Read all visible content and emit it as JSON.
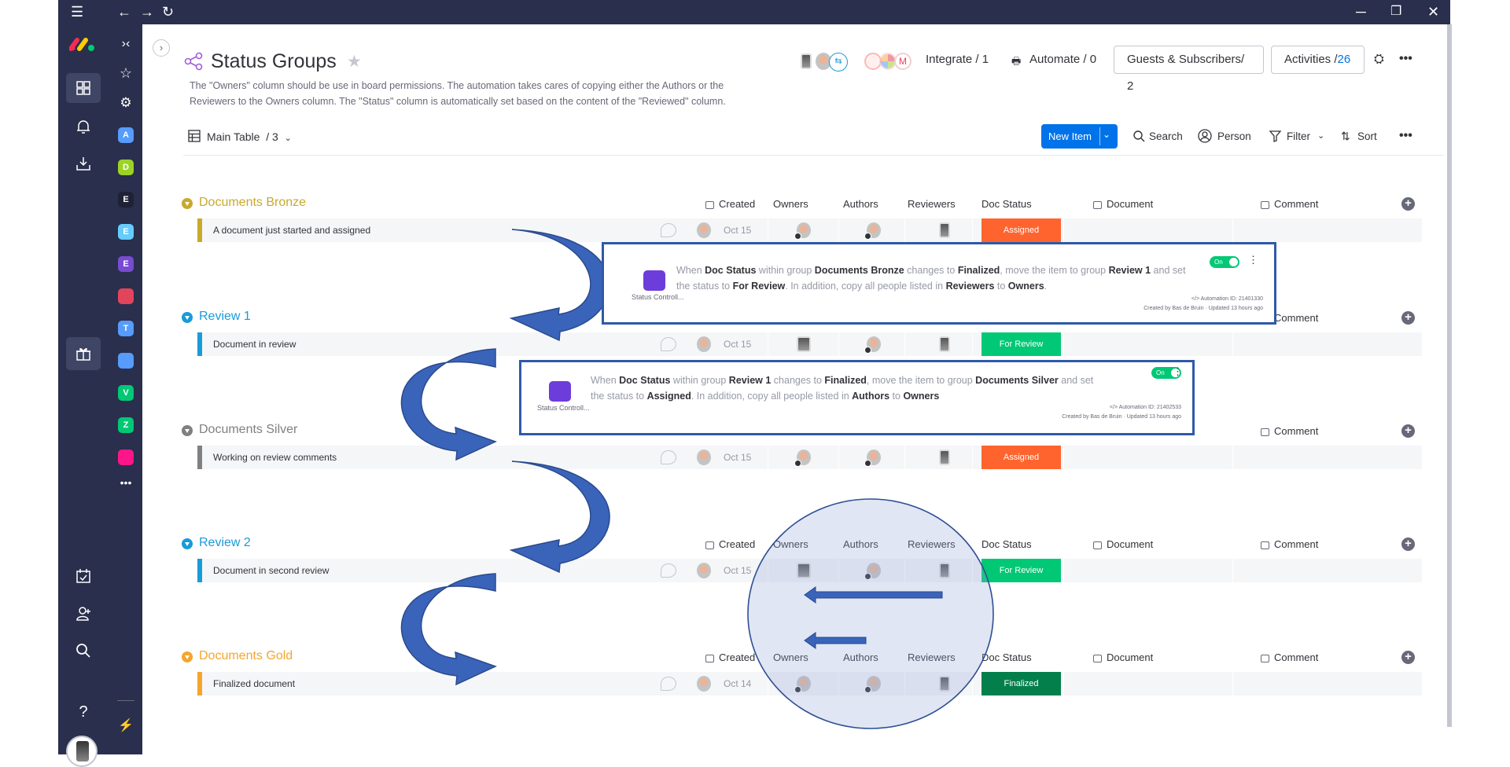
{
  "board": {
    "title": "Status Groups",
    "description_line1": "The \"Owners\" column should be use in board permissions. The automation takes cares of copying either the Authors or the",
    "description_line2": "Reviewers to the Owners column. The \"Status\" column is automatically set based on the content of the \"Reviewed\" column.",
    "integrate": "Integrate / 1",
    "automate": "Automate / 0",
    "guests": "Guests & Subscribers/ 2",
    "activities_label": "Activities /",
    "activities_count": "26"
  },
  "toolbar": {
    "view": "Main Table",
    "view_count": "/ 3",
    "new_item": "New Item",
    "search": "Search",
    "person": "Person",
    "filter": "Filter",
    "sort": "Sort"
  },
  "columns": {
    "created": "Created",
    "owners": "Owners",
    "authors": "Authors",
    "reviewers": "Reviewers",
    "doc_status": "Doc Status",
    "document": "Document",
    "comment": "Comment"
  },
  "groups": [
    {
      "title": "Documents Bronze",
      "color": "#c9a92c",
      "item": "A document just started and assigned",
      "date": "Oct 15",
      "status": "Assigned",
      "status_color": "#ff642e"
    },
    {
      "title": "Review 1",
      "color": "#1a9bd7",
      "item": "Document in review",
      "date": "Oct 15",
      "status": "For Review",
      "status_color": "#00c875"
    },
    {
      "title": "Documents Silver",
      "color": "#808080",
      "item": "Working on review comments",
      "date": "Oct 15",
      "status": "Assigned",
      "status_color": "#ff642e"
    },
    {
      "title": "Review 2",
      "color": "#1a9bd7",
      "item": "Document in second review",
      "date": "Oct 15",
      "status": "For Review",
      "status_color": "#00c875"
    },
    {
      "title": "Documents Gold",
      "color": "#f5a52c",
      "item": "Finalized document",
      "date": "Oct 14",
      "status": "Finalized",
      "status_color": "#037f4c"
    }
  ],
  "automations": [
    {
      "app": "Status Controll...",
      "toggle": "On",
      "line1": [
        {
          "t": "When ",
          "b": false
        },
        {
          "t": "Doc Status",
          "b": true
        },
        {
          "t": " within group ",
          "b": false
        },
        {
          "t": "Documents Bronze",
          "b": true
        },
        {
          "t": " changes to ",
          "b": false
        },
        {
          "t": "Finalized",
          "b": true
        },
        {
          "t": ", move the item to group ",
          "b": false
        },
        {
          "t": "Review 1",
          "b": true
        },
        {
          "t": " and set",
          "b": false
        }
      ],
      "line2": [
        {
          "t": "the status to ",
          "b": false
        },
        {
          "t": "For Review",
          "b": true
        },
        {
          "t": ". In addition, copy all people listed in ",
          "b": false
        },
        {
          "t": "Reviewers",
          "b": true
        },
        {
          "t": " to ",
          "b": false
        },
        {
          "t": "Owners",
          "b": true
        },
        {
          "t": ".",
          "b": false
        }
      ],
      "id": "</> Automation ID: 21401330",
      "created_by": "Created by Bas de Bruin · Updated 13 hours ago"
    },
    {
      "app": "Status Controll...",
      "toggle": "On",
      "line1": [
        {
          "t": "When ",
          "b": false
        },
        {
          "t": "Doc Status",
          "b": true
        },
        {
          "t": " within group ",
          "b": false
        },
        {
          "t": "Review 1",
          "b": true
        },
        {
          "t": " changes to ",
          "b": false
        },
        {
          "t": "Finalized",
          "b": true
        },
        {
          "t": ", move the item to group ",
          "b": false
        },
        {
          "t": "Documents Silver",
          "b": true
        },
        {
          "t": " and set",
          "b": false
        }
      ],
      "line2": [
        {
          "t": "the status to ",
          "b": false
        },
        {
          "t": "Assigned",
          "b": true
        },
        {
          "t": ". In addition, copy all people listed in ",
          "b": false
        },
        {
          "t": "Authors",
          "b": true
        },
        {
          "t": " to ",
          "b": false
        },
        {
          "t": "Owners",
          "b": true
        }
      ],
      "id": "</> Automation ID: 21402533",
      "created_by": "Created by Bas de Bruin · Updated 13 hours ago"
    }
  ],
  "sidebar": {
    "workspaces": [
      {
        "letter": "A",
        "color": "#579bfc"
      },
      {
        "letter": "D",
        "color": "#9cd326"
      },
      {
        "letter": "E",
        "color": "#1f2236"
      },
      {
        "letter": "E",
        "color": "#66ccff"
      },
      {
        "letter": "E",
        "color": "#784bd1"
      },
      {
        "letter": "",
        "color": "#e2445c"
      },
      {
        "letter": "T",
        "color": "#579bfc"
      },
      {
        "letter": "",
        "color": "#579bfc"
      },
      {
        "letter": "V",
        "color": "#00c875"
      },
      {
        "letter": "Z",
        "color": "#00c875"
      },
      {
        "letter": "",
        "color": "#ff158a"
      }
    ]
  },
  "colors": {
    "nav": "#292f4c",
    "primary": "#0073ea",
    "annotation": "#2e5aa8"
  }
}
